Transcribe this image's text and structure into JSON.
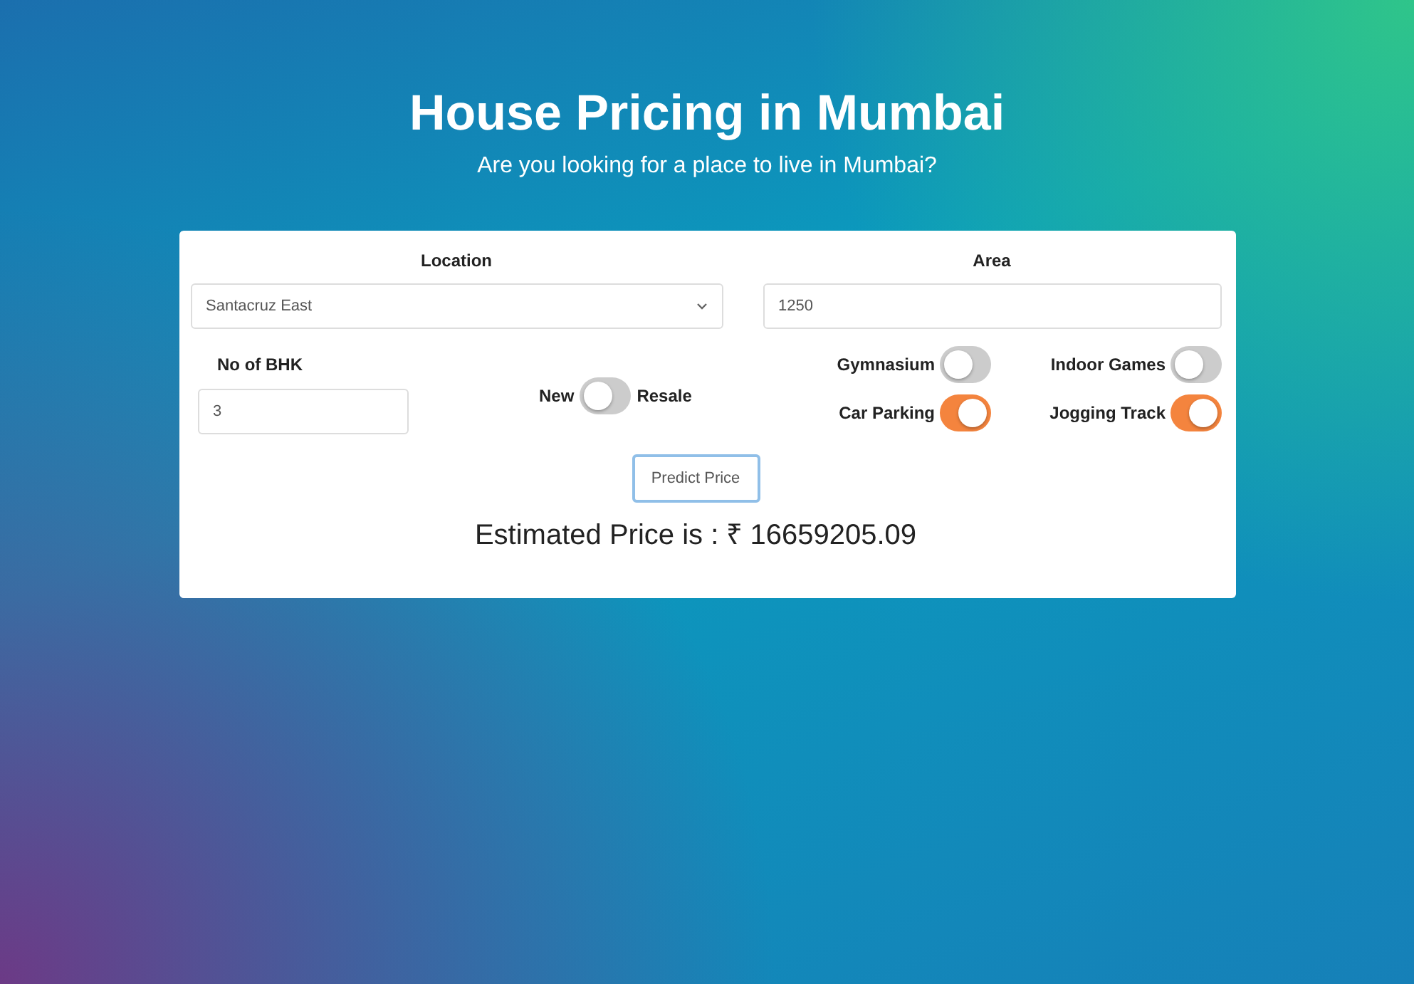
{
  "header": {
    "title": "House Pricing in Mumbai",
    "subtitle": "Are you looking for a place to live in Mumbai?"
  },
  "form": {
    "location": {
      "label": "Location",
      "value": "Santacruz East"
    },
    "area": {
      "label": "Area",
      "value": "1250"
    },
    "bhk": {
      "label": "No of BHK",
      "value": "3"
    },
    "listing_type": {
      "left_label": "New",
      "right_label": "Resale",
      "on": false
    },
    "amenities": [
      {
        "label": "Gymnasium",
        "on": false
      },
      {
        "label": "Indoor Games",
        "on": false
      },
      {
        "label": "Car Parking",
        "on": true
      },
      {
        "label": "Jogging Track",
        "on": true
      }
    ],
    "button": "Predict Price",
    "result": "Estimated Price is : ₹ 16659205.09"
  }
}
